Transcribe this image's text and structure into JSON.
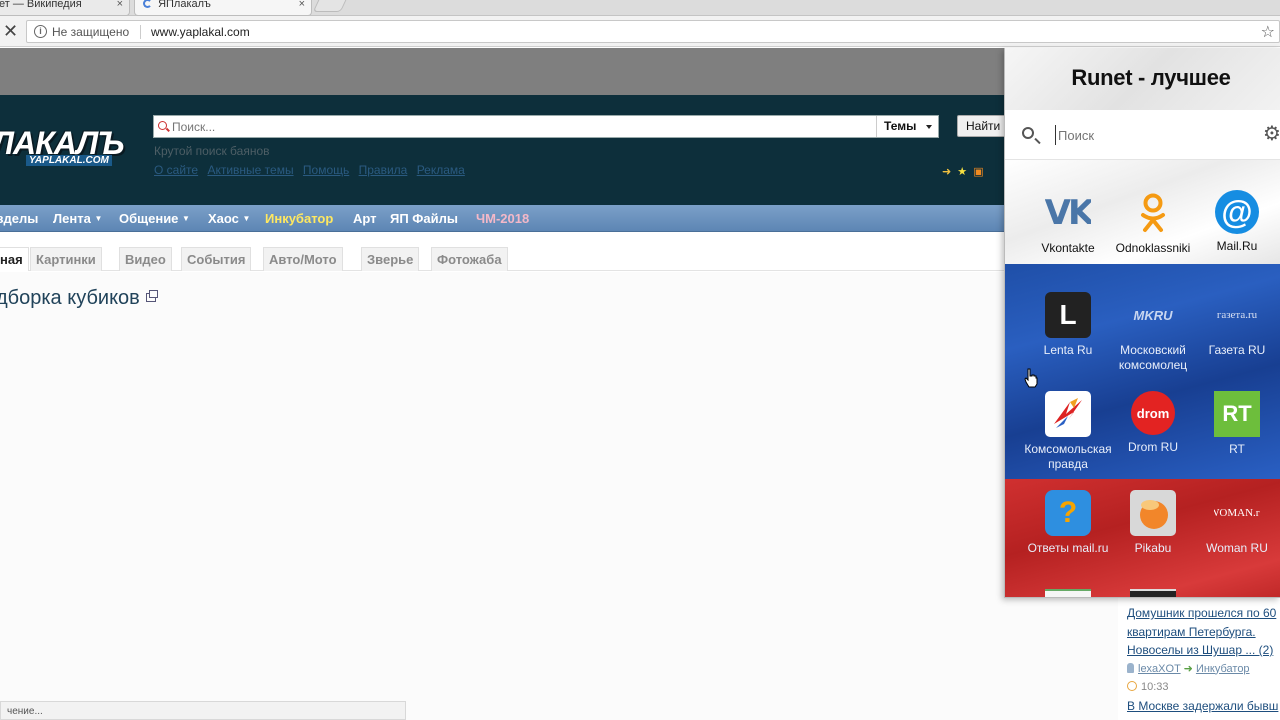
{
  "browser": {
    "tabs": [
      {
        "title": "ет — Википедия",
        "close": "×"
      },
      {
        "title": "ЯПлакалъ",
        "close": "×"
      }
    ],
    "stop_glyph": "✕",
    "security_label": "Не защищено",
    "url": "www.yaplakal.com"
  },
  "site": {
    "logo_main": "ЛАКАЛЪ",
    "logo_sub": "YAPLAKAL.COM",
    "search_placeholder": "Поиск...",
    "themes_label": "Темы",
    "find_label": "Найти",
    "slogan": "Крутой поиск баянов",
    "header_links": [
      "О сайте",
      "Активные темы",
      "Помощь",
      "Правила",
      "Реклама"
    ],
    "nav": [
      {
        "label": "зделы",
        "dropdown": false,
        "style": "normal"
      },
      {
        "label": "Лента",
        "dropdown": true,
        "style": "normal"
      },
      {
        "label": "Общение",
        "dropdown": true,
        "style": "normal"
      },
      {
        "label": "Хаос",
        "dropdown": true,
        "style": "normal"
      },
      {
        "label": "Инкубатор",
        "dropdown": false,
        "style": "yellow"
      },
      {
        "label": "Арт",
        "dropdown": false,
        "style": "normal"
      },
      {
        "label": "ЯП Файлы",
        "dropdown": false,
        "style": "normal"
      },
      {
        "label": "ЧМ-2018",
        "dropdown": false,
        "style": "pink"
      }
    ],
    "subtabs": [
      "ная",
      "Картинки",
      "Видео",
      "События",
      "Авто/Мото",
      "Зверье",
      "Фотожаба"
    ],
    "post_title": "дборка кубиков",
    "status_text": "чение...",
    "news": [
      {
        "lines": [
          "Домушник прошелся по 60",
          "квартирам Петербурга.",
          "Новоселы из Шушар ... (2)"
        ],
        "user": "lexaXOT",
        "category": "Инкубатор",
        "time": "10:33"
      },
      {
        "lines": [
          "В Москве задержали бывш"
        ]
      }
    ]
  },
  "popup": {
    "title": "Runet - лучшее",
    "search_placeholder": "Поиск",
    "sites": [
      {
        "label": "Vkontakte",
        "icon": "vk-icon",
        "glyph": "VK"
      },
      {
        "label": "Odnoklassniki",
        "icon": "ok-icon",
        "glyph": "ꆜ"
      },
      {
        "label": "Mail.Ru",
        "icon": "mail-icon",
        "glyph": "@"
      },
      {
        "label": "Lenta Ru",
        "icon": "lenta-icon",
        "glyph": "L"
      },
      {
        "label": "Московский комсомолец",
        "icon": "mk-icon",
        "glyph": "MKRU"
      },
      {
        "label": "Газета RU",
        "icon": "gazeta-icon",
        "glyph": "газета.ru"
      },
      {
        "label": "Комсомольская правда",
        "icon": "kp-icon",
        "glyph": ""
      },
      {
        "label": "Drom RU",
        "icon": "drom-icon",
        "glyph": "drom"
      },
      {
        "label": "RT",
        "icon": "rt-icon",
        "glyph": "RT"
      },
      {
        "label": "Ответы mail.ru",
        "icon": "otvet-icon",
        "glyph": "?"
      },
      {
        "label": "Pikabu",
        "icon": "pikabu-icon",
        "glyph": ""
      },
      {
        "label": "Woman RU",
        "icon": "woman-icon",
        "glyph": "WOMAN.ru"
      }
    ]
  }
}
